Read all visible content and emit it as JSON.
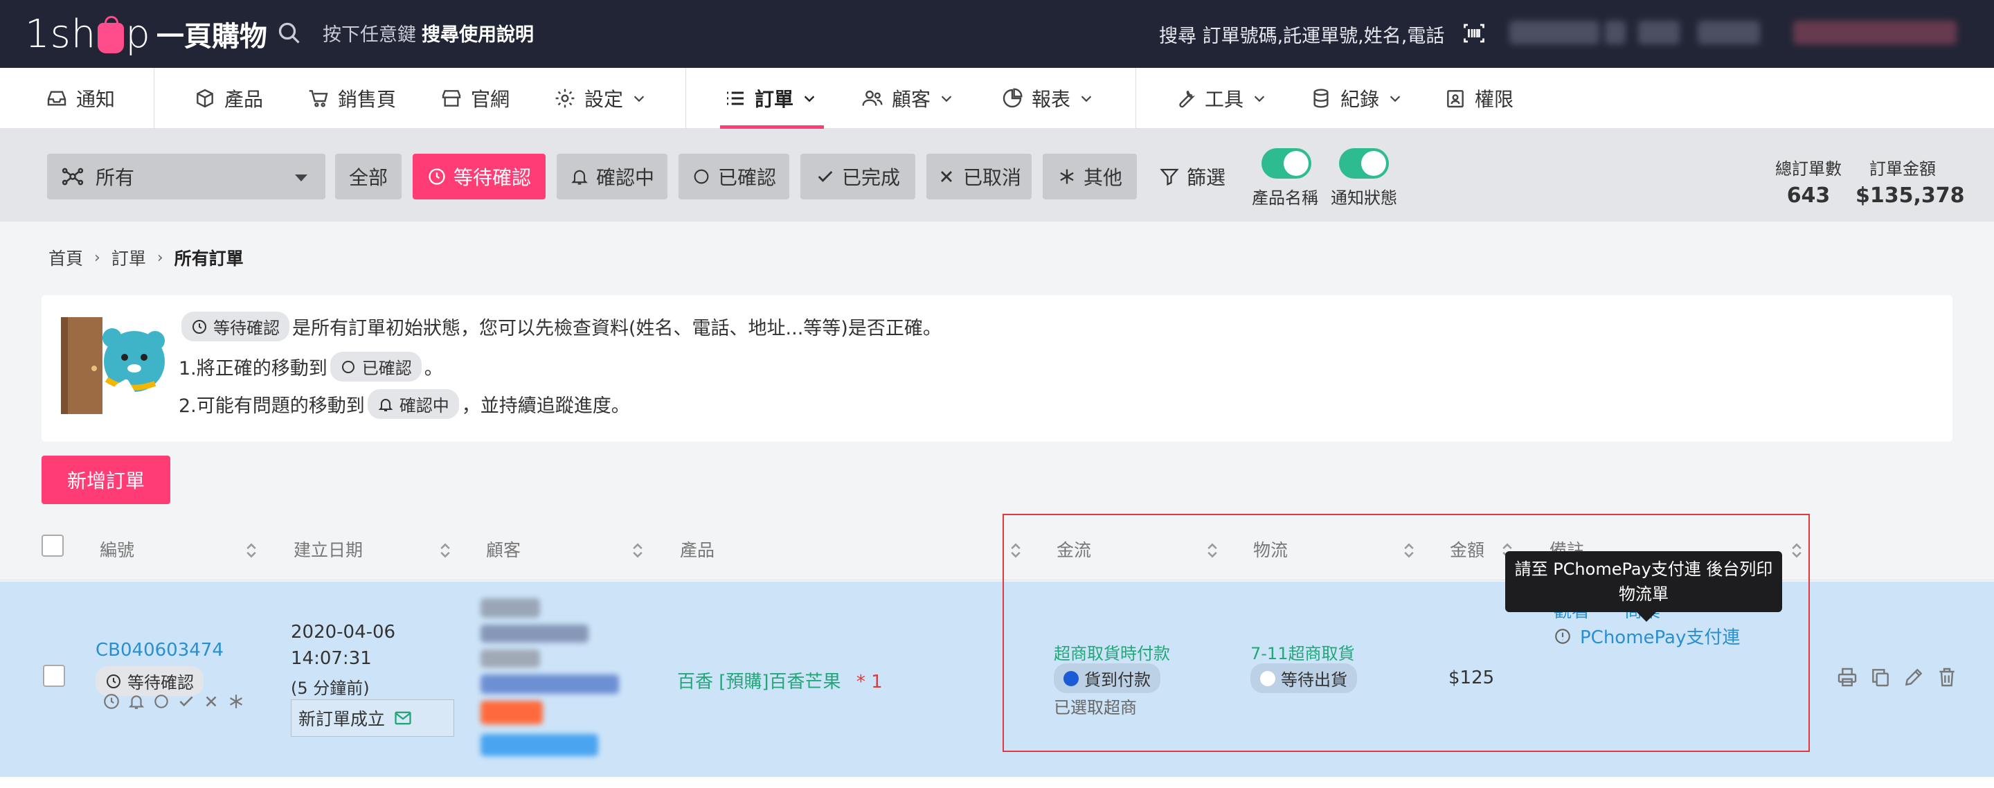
{
  "topbar": {
    "logo_text": "1sh",
    "logo_text2": "p",
    "logo_cn": "一頁購物",
    "hint": "按下任意鍵",
    "hint_bold": "搜尋使用說明",
    "search_placeholder": "搜尋 訂單號碼,託運單號,姓名,電話"
  },
  "nav": {
    "notify": "通知",
    "products": "產品",
    "sales_page": "銷售頁",
    "website": "官網",
    "settings": "設定",
    "orders": "訂單",
    "customers": "顧客",
    "reports": "報表",
    "tools": "工具",
    "records": "紀錄",
    "permissions": "權限"
  },
  "filter": {
    "select_value": "所有",
    "all": "全部",
    "pending": "等待確認",
    "confirming": "確認中",
    "confirmed": "已確認",
    "completed": "已完成",
    "cancelled": "已取消",
    "other": "其他",
    "filter": "篩選",
    "toggle_product_name": "產品名稱",
    "toggle_notify_status": "通知狀態",
    "total_orders_label": "總訂單數",
    "total_orders": "643",
    "total_amount_label": "訂單金額",
    "total_amount": "$135,378"
  },
  "breadcrumb": {
    "home": "首頁",
    "orders": "訂單",
    "current": "所有訂單"
  },
  "info": {
    "pill_pending": "等待確認",
    "line1": "是所有訂單初始狀態，您可以先檢查資料(姓名、電話、地址...等等)是否正確。",
    "line2_pre": "1.將正確的移動到",
    "pill_confirmed": "已確認",
    "line2_post": "。",
    "line3_pre": "2.可能有問題的移動到",
    "pill_confirming": "確認中",
    "line3_post": "，並持續追蹤進度。"
  },
  "new_order": "新增訂單",
  "table": {
    "headers": {
      "id": "編號",
      "created": "建立日期",
      "customer": "顧客",
      "product": "產品",
      "payment": "金流",
      "logistics": "物流",
      "amount": "金額",
      "notes": "備註"
    },
    "row": {
      "order_id": "CB040603474",
      "status": "等待確認",
      "date": "2020-04-06",
      "time": "14:07:31",
      "ago": "(5 分鐘前)",
      "note": "新訂單成立",
      "product": "百香 [預購]百香芒果",
      "qty": "* 1",
      "payment_method": "超商取貨時付款",
      "payment_status": "貨到付款",
      "payment_sub": "已選取超商",
      "logistics_method": "7-11超商取貨",
      "logistics_status": "等待出貨",
      "amount": "$125",
      "note_link1": "觀看",
      "note_link1b": "商業",
      "note_link2": "PChomePay支付連"
    }
  },
  "tooltip": {
    "line1": "請至 PChomePay支付連 後台列印",
    "line2": "物流單"
  },
  "colors": {
    "primary": "#ff3c74",
    "dark": "#222536",
    "toggle": "#2cbc8f",
    "link": "#2a8fd1",
    "green": "#22a67a",
    "row_bg": "#cde4f8",
    "highlight": "#e3393c"
  }
}
